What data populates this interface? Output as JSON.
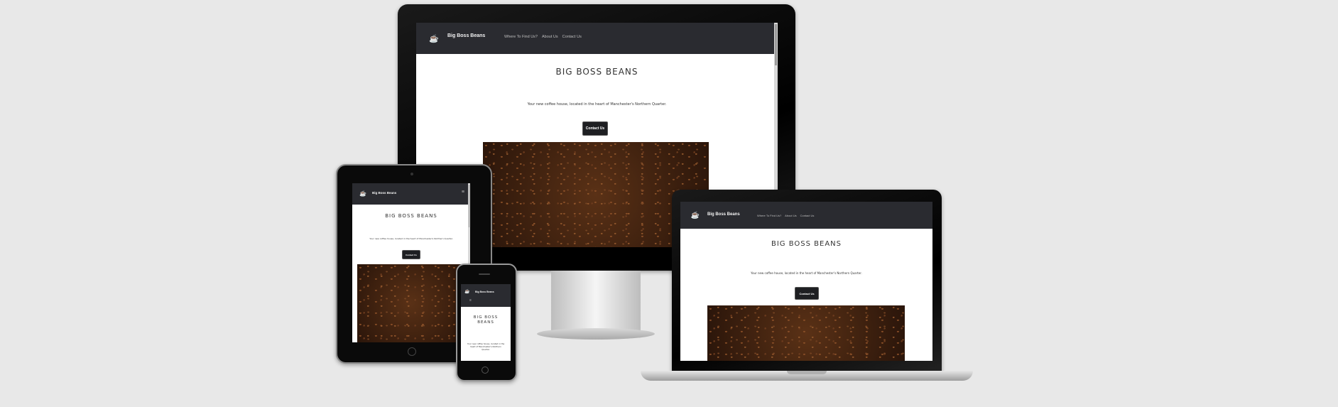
{
  "site": {
    "brand": "Big Boss Beans",
    "logo_icon": "coffee-cup-logo-icon",
    "nav": [
      "Where To Find Us?",
      "About Us",
      "Contact Us"
    ],
    "hero_title": "BIG BOSS BEANS",
    "hero_title_mobile_line1": "BIG BOSS",
    "hero_title_mobile_line2": "BEANS",
    "tagline": "Your new coffee house, located in the heart of Manchester's Northern Quarter.",
    "tagline_mobile": "Your new coffee house, located in the heart of Manchester's Northern Quarter.",
    "cta": "Contact Us",
    "hamburger_icon": "≡"
  },
  "colors": {
    "header": "#2a2b30",
    "accent": "#d9721c",
    "button": "#1e1f22",
    "background": "#e8e8e8"
  }
}
